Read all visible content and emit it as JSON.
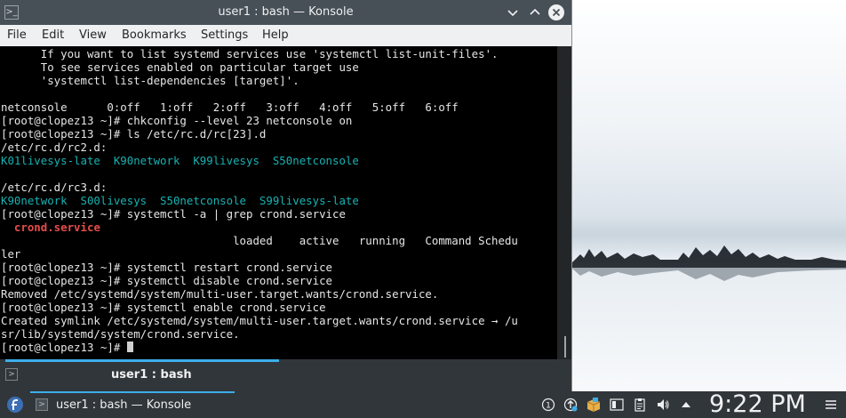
{
  "window": {
    "title": "user1 : bash — Konsole"
  },
  "menubar": [
    "File",
    "Edit",
    "View",
    "Bookmarks",
    "Settings",
    "Help"
  ],
  "terminal": {
    "lines": [
      [
        {
          "t": "      If you want to list systemd services use 'systemctl list-unit-files'."
        }
      ],
      [
        {
          "t": "      To see services enabled on particular target use"
        }
      ],
      [
        {
          "t": "      'systemctl list-dependencies [target]'."
        }
      ],
      [
        {
          "t": ""
        }
      ],
      [
        {
          "t": "netconsole      0:off   1:off   2:off   3:off   4:off   5:off   6:off"
        }
      ],
      [
        {
          "t": "[root@clopez13 ~]# chkconfig --level 23 netconsole on"
        }
      ],
      [
        {
          "t": "[root@clopez13 ~]# ls /etc/rc.d/rc[23].d"
        }
      ],
      [
        {
          "t": "/etc/rc.d/rc2.d:"
        }
      ],
      [
        {
          "t": "K01livesys-late  K90network  K99livesys  S50netconsole",
          "c": "cyan"
        }
      ],
      [
        {
          "t": ""
        }
      ],
      [
        {
          "t": "/etc/rc.d/rc3.d:"
        }
      ],
      [
        {
          "t": "K90network  S00livesys  S50netconsole  S99livesys-late",
          "c": "cyan"
        }
      ],
      [
        {
          "t": "[root@clopez13 ~]# systemctl -a | grep crond.service"
        }
      ],
      [
        {
          "t": "  "
        },
        {
          "t": "crond.service",
          "c": "red"
        }
      ],
      [
        {
          "t": "                                   loaded    active   running   Command Schedu"
        }
      ],
      [
        {
          "t": "ler"
        }
      ],
      [
        {
          "t": "[root@clopez13 ~]# systemctl restart crond.service"
        }
      ],
      [
        {
          "t": "[root@clopez13 ~]# systemctl disable crond.service"
        }
      ],
      [
        {
          "t": "Removed /etc/systemd/system/multi-user.target.wants/crond.service."
        }
      ],
      [
        {
          "t": "[root@clopez13 ~]# systemctl enable crond.service"
        }
      ],
      [
        {
          "t": "Created symlink /etc/systemd/system/multi-user.target.wants/crond.service → /u"
        }
      ],
      [
        {
          "t": "sr/lib/systemd/system/crond.service."
        }
      ],
      [
        {
          "t": "[root@clopez13 ~]# "
        },
        {
          "cursor": true
        }
      ]
    ]
  },
  "tab": {
    "label": "user1 : bash"
  },
  "taskbar": {
    "task_label": "user1 : bash — Konsole",
    "clock": "9:22 PM",
    "tray_icons": [
      "notifications-icon",
      "updates-icon",
      "package-icon",
      "display-icon",
      "volume-icon",
      "clipboard-icon",
      "network-icon",
      "expand-tray-icon"
    ]
  },
  "colors": {
    "accent": "#3daee9",
    "titlebar": "#475057",
    "panel": "#31363b",
    "terminal_bg": "#000000",
    "cyan": "#18b2b2",
    "red": "#e74c4c"
  }
}
